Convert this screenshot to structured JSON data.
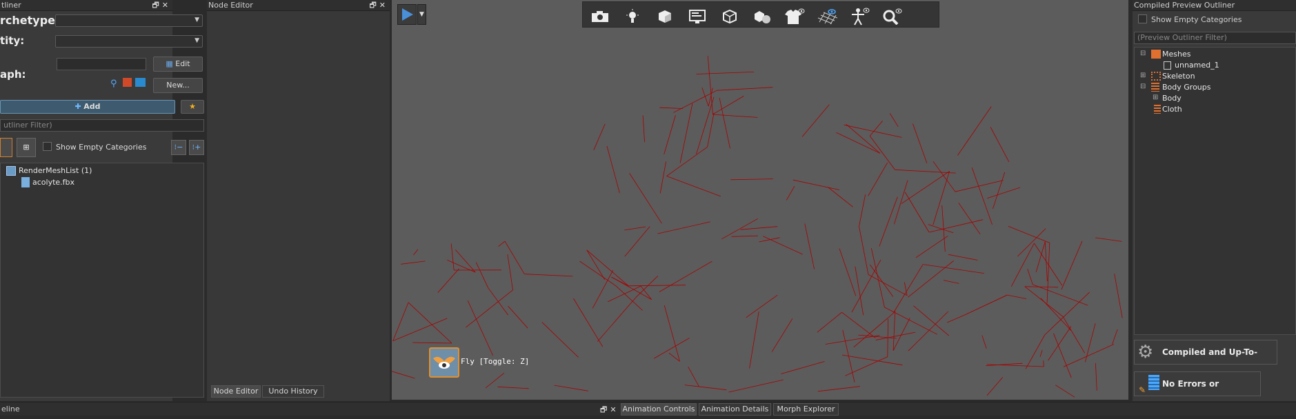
{
  "left_panel": {
    "title": "tliner",
    "archetype_label": "rchetype:",
    "entity_label": "tity:",
    "graph_label": "aph:",
    "edit_label": "Edit",
    "new_label": "New...",
    "add_label": "Add",
    "filter_placeholder": "utliner Filter)",
    "show_empty_label": "Show Empty Categories",
    "tree": {
      "root_label": "RenderMeshList (1)",
      "child_label": "acolyte.fbx"
    }
  },
  "node_editor": {
    "title": "Node Editor",
    "tabs": [
      "Node Editor",
      "Undo History"
    ]
  },
  "viewport": {
    "fly_label": "Fly [Toggle: Z]",
    "toolbar_icons": [
      "camera-icon",
      "light-bulb-icon",
      "cube-solid-icon",
      "monitor-icon",
      "cube-wire-icon",
      "shapes-icon",
      "shirt-eye-icon",
      "grid-eye-icon",
      "skeleton-eye-icon",
      "zoom-icon"
    ],
    "wire_color": "#a80000",
    "bg_color": "#5c5c5c"
  },
  "right_panel": {
    "title": "Compiled Preview Outliner",
    "show_empty_label": "Show Empty Categories",
    "filter_placeholder": "(Preview Outliner Filter)",
    "tree": {
      "meshes": "Meshes",
      "unnamed": "unnamed_1",
      "skeleton": "Skeleton",
      "body_groups": "Body Groups",
      "body": "Body",
      "cloth": "Cloth"
    },
    "status_compiled": "Compiled and Up-To-Date",
    "status_warnings": "No Errors or Warnings"
  },
  "bottom": {
    "timeline_label": "eline",
    "tabs": [
      "Animation Controls",
      "Animation Details",
      "Morph Explorer"
    ]
  }
}
